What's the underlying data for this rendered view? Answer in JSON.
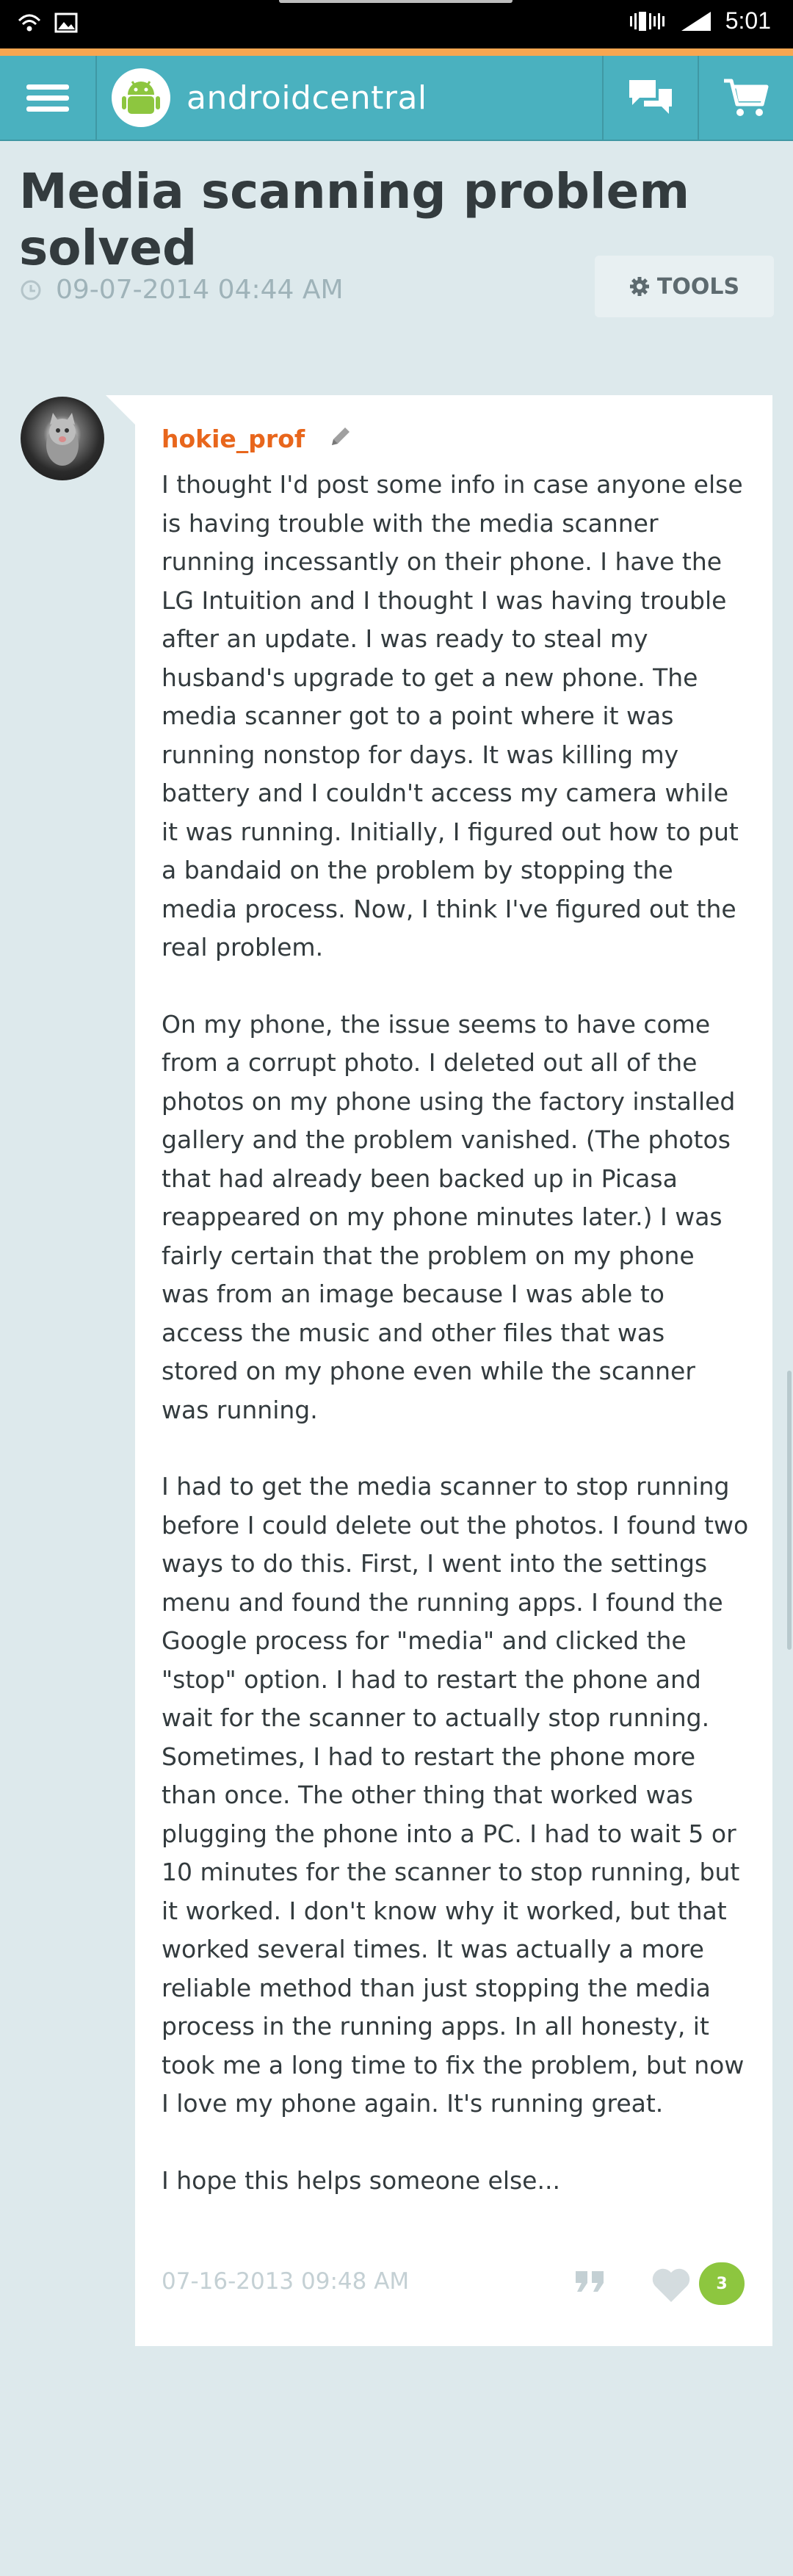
{
  "status_bar": {
    "time": "5:01"
  },
  "nav": {
    "brand": "androidcentral",
    "menu_icon": "hamburger-menu-icon",
    "chat_icon": "chat-bubbles-icon",
    "cart_icon": "shopping-cart-icon"
  },
  "thread": {
    "title": "Media scanning problem solved",
    "date": "09-07-2014 04:44 AM",
    "tools_label": "TOOLS"
  },
  "post": {
    "username": "hokie_prof",
    "paragraphs": [
      "I thought I'd post some info in case anyone else is having trouble with the media scanner running incessantly on their phone. I have the LG Intuition and I thought I was having trouble after an update. I was ready to steal my husband's upgrade to get a new phone. The media scanner got to a point where it was running nonstop for days. It was killing my battery and I couldn't access my camera while it was running. Initially, I figured out how to put a bandaid on the problem by stopping the media process. Now, I think I've figured out the real problem.",
      "On my phone, the issue seems to have come from a corrupt photo. I deleted out all of the photos on my phone using the factory installed gallery and the problem vanished. (The photos that had already been backed up in Picasa reappeared on my phone minutes later.) I was fairly certain that the problem on my phone was from an image because I was able to access the music and other files that was stored on my phone even while the scanner was running.",
      "I had to get the media scanner to stop running before I could delete out the photos. I found two ways to do this. First, I went into the settings menu and found the running apps. I found the Google process for \"media\" and clicked the \"stop\" option. I had to restart the phone and wait for the scanner to actually stop running. Sometimes, I had to restart the phone more than once. The other thing that worked was plugging the phone into a PC. I had to wait 5 or 10 minutes for the scanner to stop running, but it worked. I don't know why it worked, but that worked several times. It was actually a more reliable method than just stopping the media process in the running apps. In all honesty, it took me a long time to fix the problem, but now I love my phone again. It's running great.",
      "I hope this helps someone else..."
    ],
    "post_date": "07-16-2013 09:48 AM",
    "like_count": "3"
  },
  "colors": {
    "nav_bg": "#4ab1bf",
    "accent_orange": "#f7a650",
    "username": "#e8661c",
    "like_green": "#8dc63f",
    "page_bg": "#dde9ec"
  }
}
